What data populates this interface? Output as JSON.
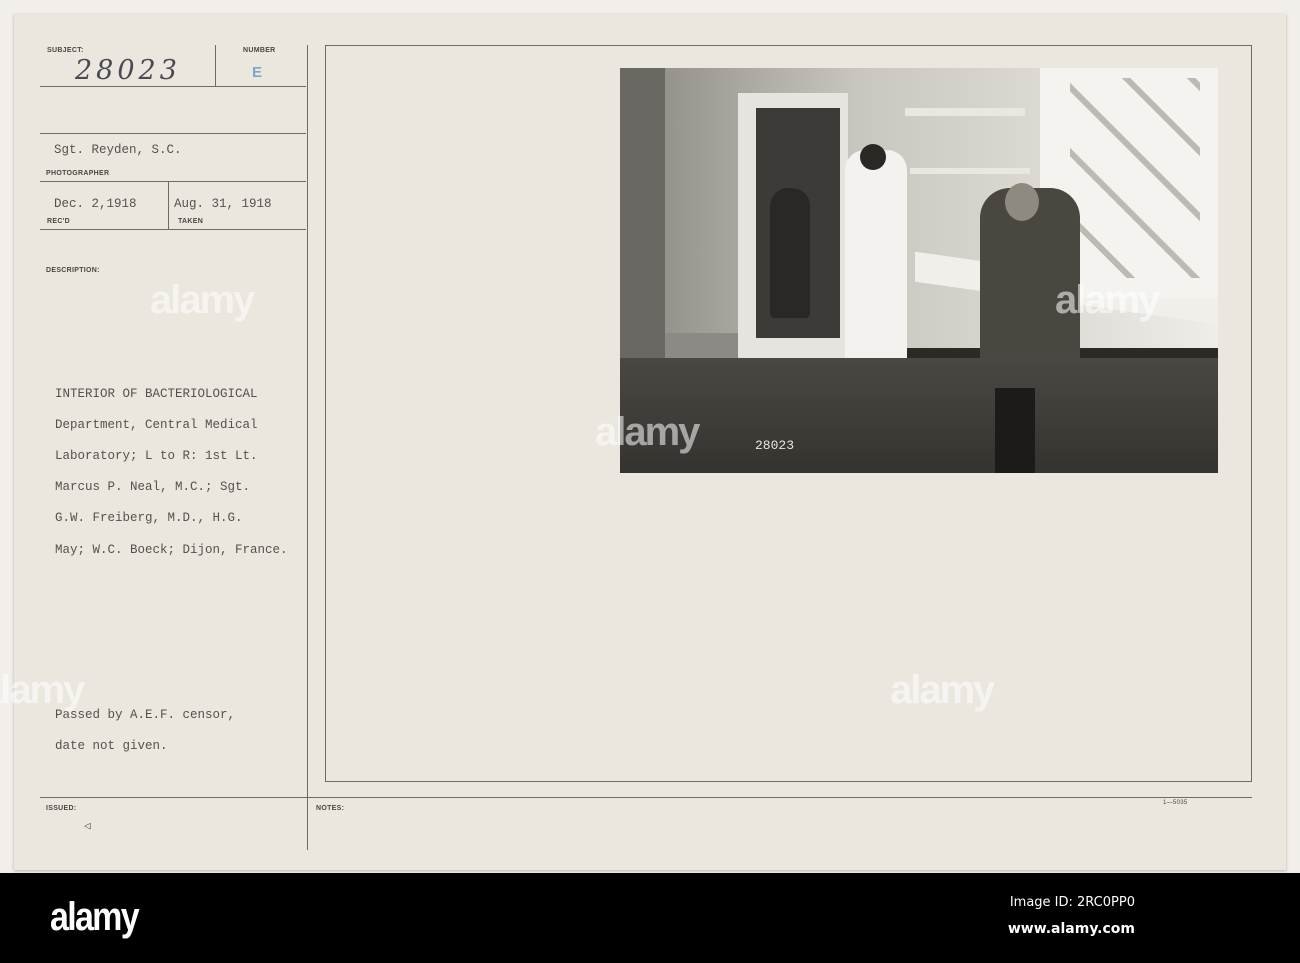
{
  "card": {
    "subject_label": "SUBJECT:",
    "subject_value": "28023",
    "number_label": "NUMBER",
    "number_value": "E",
    "photographer_value": "Sgt. Reyden, S.C.",
    "photographer_label": "PHOTOGRAPHER",
    "received_value": "Dec. 2,1918",
    "received_label": "REC'D",
    "taken_value": "Aug. 31, 1918",
    "taken_label": "TAKEN",
    "description_label": "DESCRIPTION:",
    "description_lines": [
      "INTERIOR OF BACTERIOLOGICAL",
      "Department, Central Medical",
      "Laboratory; L to R: 1st Lt.",
      "Marcus P. Neal, M.C.; Sgt.",
      "G.W. Freiberg, M.D., H.G.",
      "May; W.C. Boeck; Dijon, France."
    ],
    "censor_lines": [
      "Passed by A.E.F. censor,",
      "date not given."
    ],
    "issued_label": "ISSUED:",
    "issued_mark": "◁",
    "notes_label": "NOTES:",
    "form_number": "1—5035",
    "photo_number": "28023"
  },
  "watermark": {
    "text": "alamy"
  },
  "banner": {
    "logo": "alamy",
    "image_id": "Image ID: 2RC0PP0",
    "site": "www.alamy.com"
  }
}
